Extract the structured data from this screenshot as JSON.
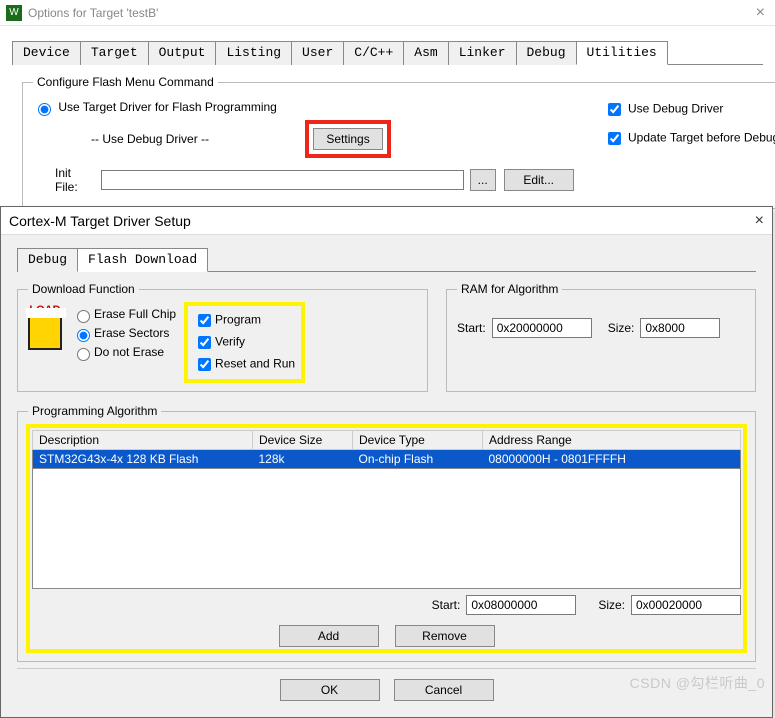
{
  "window1": {
    "title": "Options for Target 'testB'",
    "tabs": [
      "Device",
      "Target",
      "Output",
      "Listing",
      "User",
      "C/C++",
      "Asm",
      "Linker",
      "Debug",
      "Utilities"
    ],
    "active_tab": 9,
    "flash_group_title": "Configure Flash Menu Command",
    "use_target_driver": "Use Target Driver for Flash Programming",
    "use_debug_driver_display": "-- Use Debug Driver --",
    "settings_btn": "Settings",
    "use_debug_driver_chk": "Use Debug Driver",
    "update_target_chk": "Update Target before Debugging",
    "init_file_label": "Init File:",
    "init_file_value": "",
    "browse_btn": "...",
    "edit_btn": "Edit..."
  },
  "dialog2": {
    "title": "Cortex-M Target Driver Setup",
    "tabs": [
      "Debug",
      "Flash Download"
    ],
    "active_tab": 1,
    "dlfunc": {
      "group": "Download Function",
      "load_label": "LOAD",
      "r_erase_full": "Erase Full Chip",
      "r_erase_sectors": "Erase Sectors",
      "r_do_not_erase": "Do not Erase",
      "c_program": "Program",
      "c_verify": "Verify",
      "c_reset_run": "Reset and Run"
    },
    "ram": {
      "group": "RAM for Algorithm",
      "start_label": "Start:",
      "start_value": "0x20000000",
      "size_label": "Size:",
      "size_value": "0x8000"
    },
    "algo": {
      "group": "Programming Algorithm",
      "headers": [
        "Description",
        "Device Size",
        "Device Type",
        "Address Range"
      ],
      "row": {
        "desc": "STM32G43x-4x 128 KB Flash",
        "size": "128k",
        "type": "On-chip Flash",
        "range": "08000000H - 0801FFFFH"
      },
      "start_label": "Start:",
      "start_value": "0x08000000",
      "size_label": "Size:",
      "size_value": "0x00020000",
      "add_btn": "Add",
      "remove_btn": "Remove"
    },
    "buttons": {
      "ok": "OK",
      "cancel": "Cancel"
    }
  },
  "watermark": "CSDN @勾栏听曲_0"
}
